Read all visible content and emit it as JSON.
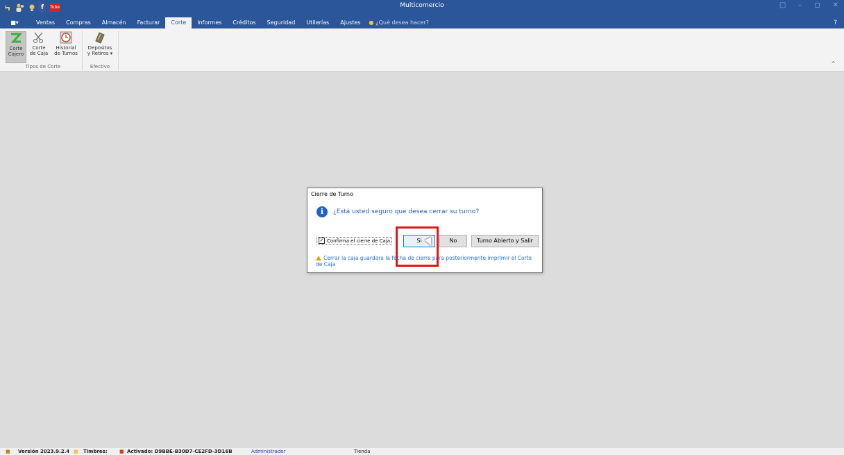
{
  "window": {
    "title": "Multicomercio",
    "quick_access_icons": [
      "back-arrow-icon",
      "users-icon",
      "bulb-icon",
      "facebook-icon",
      "youtube-icon"
    ],
    "facebook_text": "f",
    "youtube_text": "Tube",
    "controls": [
      "restore-down-icon",
      "minimize-icon",
      "maximize-icon",
      "close-icon"
    ],
    "help_label": "?"
  },
  "menu": {
    "file_label": "■▾",
    "tabs": [
      {
        "label": "Ventas"
      },
      {
        "label": "Compras"
      },
      {
        "label": "Almacén"
      },
      {
        "label": "Facturar"
      },
      {
        "label": "Corte",
        "active": true
      },
      {
        "label": "Informes"
      },
      {
        "label": "Créditos"
      },
      {
        "label": "Seguridad"
      },
      {
        "label": "Utilerías"
      },
      {
        "label": "Ajustes"
      }
    ],
    "tell_me_placeholder": "¿Qué desea hacer?"
  },
  "ribbon": {
    "buttons": [
      {
        "label_line1": "Corte",
        "label_line2": "Cajero",
        "icon": "z-arrow-icon",
        "selected": true
      },
      {
        "label_line1": "Corte",
        "label_line2": "de Caja",
        "icon": "scissors-icon"
      },
      {
        "label_line1": "Historial",
        "label_line2": "de Turnos",
        "icon": "clock-icon"
      },
      {
        "label_line1": "Depositos",
        "label_line2": "y Retiros ▾",
        "icon": "money-icon"
      }
    ],
    "groups": [
      {
        "label": "Tipos de Corte"
      },
      {
        "label": "Efectivo"
      }
    ],
    "collapse_label": "^"
  },
  "dialog": {
    "title": "Cierre de Turno",
    "question": "¿Está usted seguro que desea cerrar su turno?",
    "checkbox_label": "Confirma el cierre de Caja",
    "checkbox_checked": true,
    "checkbox_mark": "✓",
    "buttons": {
      "yes": "Si",
      "no": "No",
      "keep_open": "Turno Abierto y Salir"
    },
    "warning": "Cerrar la caja guardara la fecha de cierre para posteriormente imprimir el Corte de Caja"
  },
  "statusbar": {
    "version": "Versión 2023.9.2.4",
    "timbres": "Timbres:",
    "activation": "Activado: D9BBE-B30D7-CE2FD-3D16B",
    "user": "Administrador",
    "store": "Tienda"
  },
  "colors": {
    "titlebar": "#2b579a",
    "accent_blue": "#1f5fb5",
    "highlight_red": "#e01717",
    "warning_yellow": "#e8a200"
  }
}
